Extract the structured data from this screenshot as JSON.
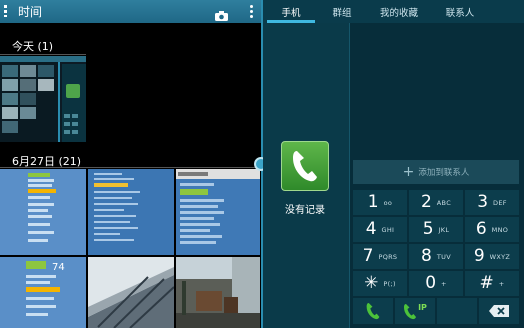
{
  "gallery": {
    "title": "时间",
    "sections": [
      {
        "label": "今天 (1)"
      },
      {
        "label": "6月27日 (21)"
      }
    ]
  },
  "phone": {
    "tabs": [
      {
        "label": "手机",
        "active": true
      },
      {
        "label": "群组",
        "active": false
      },
      {
        "label": "我的收藏",
        "active": false
      },
      {
        "label": "联系人",
        "active": false
      }
    ],
    "log_empty": "没有记录",
    "add_contact": "添加到联系人",
    "keys": [
      {
        "digit": "1",
        "letters": "ᴏᴏ"
      },
      {
        "digit": "2",
        "letters": "ABC"
      },
      {
        "digit": "3",
        "letters": "DEF"
      },
      {
        "digit": "4",
        "letters": "GHI"
      },
      {
        "digit": "5",
        "letters": "JKL"
      },
      {
        "digit": "6",
        "letters": "MNO"
      },
      {
        "digit": "7",
        "letters": "PQRS"
      },
      {
        "digit": "8",
        "letters": "TUV"
      },
      {
        "digit": "9",
        "letters": "WXYZ"
      },
      {
        "digit": "✳",
        "letters": "P(;)"
      },
      {
        "digit": "0",
        "letters": "+"
      },
      {
        "digit": "#",
        "letters": "+"
      }
    ],
    "ip_label": "IP",
    "thumb_text": "74"
  },
  "colors": {
    "accent": "#3fb8e0",
    "call_green": "#4cc23a"
  }
}
